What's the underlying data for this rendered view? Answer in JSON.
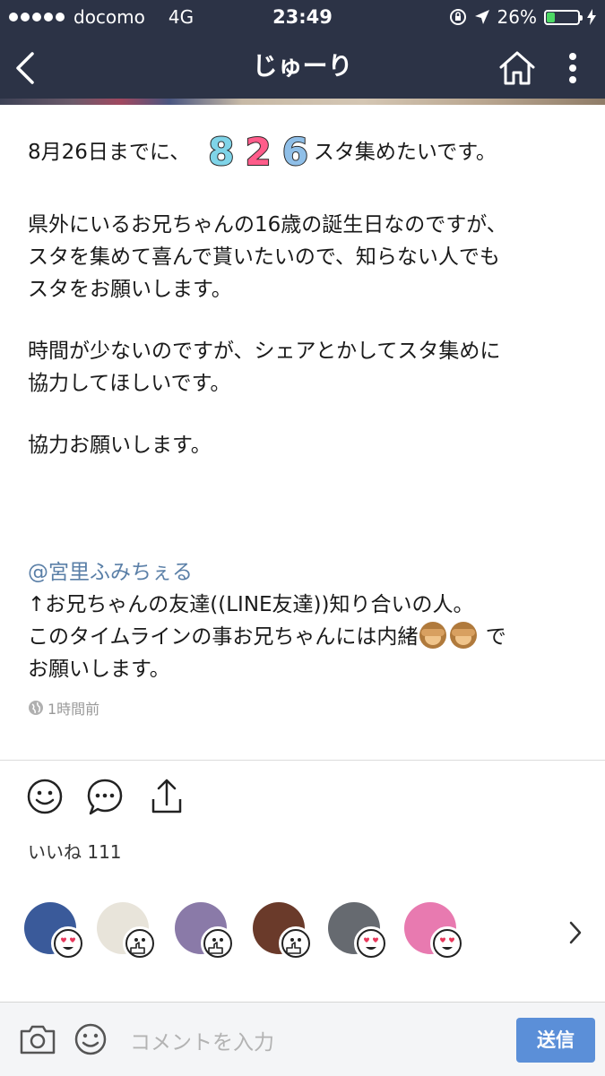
{
  "status_bar": {
    "carrier": "docomo",
    "network": "4G",
    "time": "23:49",
    "battery": "26%",
    "battery_fraction": 0.26
  },
  "header": {
    "title": "じゅーり",
    "icons": [
      "back-chevron-icon",
      "home-icon",
      "more-vertical-icon"
    ]
  },
  "post": {
    "line1_before": "8月26日までに、",
    "digits": [
      "8",
      "2",
      "6"
    ],
    "line1_after": "スタ集めたいです。",
    "para2": [
      "県外にいるお兄ちゃんの16歳の誕生日なのですが、",
      "スタを集めて喜んで貰いたいので、知らない人でも",
      "スタをお願いします。"
    ],
    "para3": [
      "時間が少ないのですが、シェアとかしてスタ集めに",
      "協力してほしいです。"
    ],
    "para4": "協力お願いします。",
    "mention": "@宮里ふみちぇる",
    "para5_line1": "↑お兄ちゃんの友達((LINE友達))知り合いの人。",
    "para5_line2_before": "このタイムラインの事お兄ちゃんには内緒",
    "para5_line2_after": " で",
    "para5_line3": "お願いします。",
    "timestamp": "1時間前"
  },
  "actions": {
    "icons": [
      "smiley-icon",
      "comment-bubble-icon",
      "share-icon"
    ]
  },
  "likes": "いいね 111",
  "avatars": [
    {
      "name": "avatar-1",
      "reaction": "heart-eyes-icon",
      "color": "#3a5a9a"
    },
    {
      "name": "avatar-2",
      "reaction": "thumbs-up-icon",
      "color": "#e8e4da"
    },
    {
      "name": "avatar-3",
      "reaction": "thumbs-up-icon",
      "color": "#8a7aa8"
    },
    {
      "name": "avatar-4",
      "reaction": "thumbs-up-icon",
      "color": "#6a3a2a"
    },
    {
      "name": "avatar-5",
      "reaction": "heart-eyes-icon",
      "color": "#666a70"
    },
    {
      "name": "avatar-6",
      "reaction": "heart-eyes-icon",
      "color": "#e87ab0"
    }
  ],
  "composer": {
    "placeholder": "コメントを入力",
    "send_label": "送信"
  },
  "colors": {
    "header_bg": "#2c3346",
    "accent": "#5b8fd8",
    "mention": "#5a7fa7",
    "digit_8": "#7fd4e8",
    "digit_2": "#ff5c8a",
    "digit_6": "#8fbfe8"
  }
}
